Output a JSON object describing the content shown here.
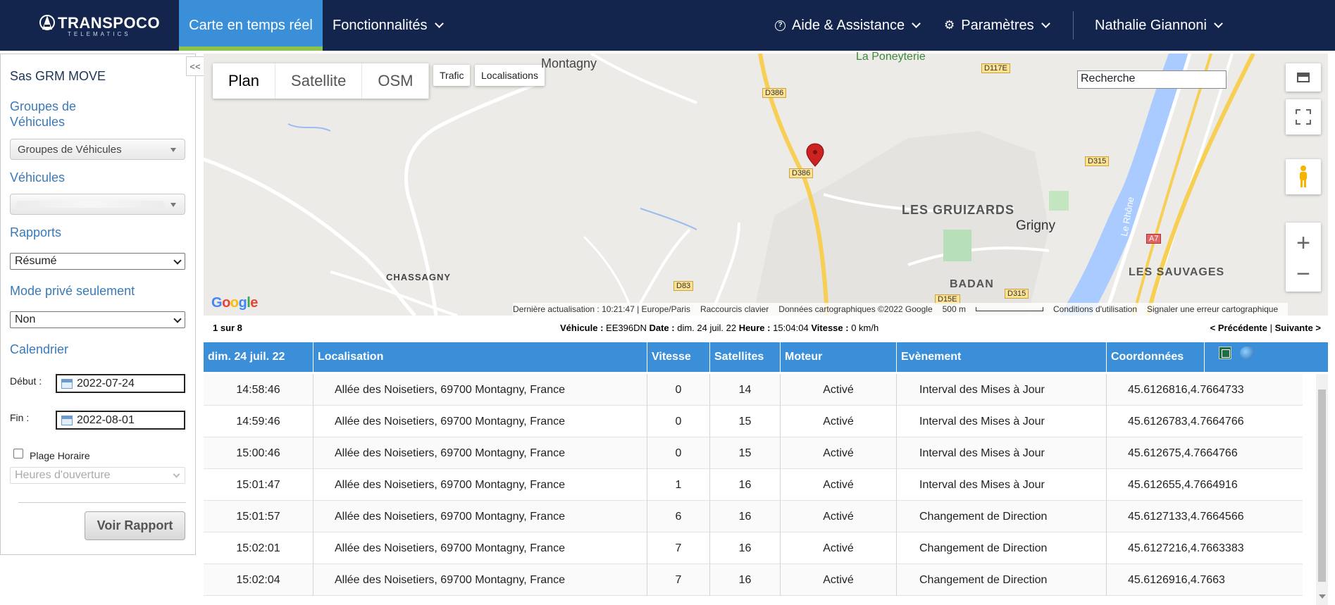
{
  "app": {
    "logo_text": "TRANSPOCO",
    "logo_sub": "TELEMATICS"
  },
  "nav": {
    "active": "Carte en temps réel",
    "features": "Fonctionnalités",
    "help": "Aide & Assistance",
    "settings": "Paramètres",
    "user": "Nathalie Giannoni"
  },
  "sidebar": {
    "collapse": "<<",
    "company": "Sas GRM MOVE",
    "groups_label": "Groupes de Véhicules",
    "groups_select": "Groupes de Véhicules",
    "vehicles_label": "Véhicules",
    "reports_label": "Rapports",
    "report_select": "Résumé",
    "private_label": "Mode privé seulement",
    "private_select": "Non",
    "calendar_label": "Calendrier",
    "start_label": "Début :",
    "start_value": "2022-07-24",
    "end_label": "Fin :",
    "end_value": "2022-08-01",
    "time_range_label": "Plage Horaire",
    "hours_select": "Heures d'ouverture",
    "report_button": "Voir Rapport"
  },
  "map": {
    "tabs": [
      "Plan",
      "Satellite",
      "OSM"
    ],
    "traffic_btn": "Trafic",
    "locations_btn": "Localisations",
    "search_placeholder": "Recherche",
    "labels": {
      "montagny": "Montagny",
      "poneyterie": "La Poneyterie",
      "gruizards": "LES GRUIZARDS",
      "grigny": "Grigny",
      "chassagny": "CHASSAGNY",
      "badan": "BADAN",
      "sauvages": "LES SAUVAGES",
      "rhone": "Le Rhône"
    },
    "roads": [
      "D386",
      "D386",
      "D117E",
      "D315",
      "D315",
      "D83",
      "D15E",
      "A7"
    ],
    "footer": {
      "last_update": "Dernière actualisation : 10:21:47 | Europe/Paris",
      "shortcuts": "Raccourcis clavier",
      "data": "Données cartographiques ©2022 Google",
      "scale": "500 m",
      "terms": "Conditions d'utilisation",
      "report": "Signaler une erreur cartographique"
    },
    "google": "Google"
  },
  "info": {
    "page": "1 sur 8",
    "vehicle_label": "Véhicule :",
    "vehicle": "EE396DN",
    "date_label": "Date :",
    "date": "dim. 24 juil. 22",
    "time_label": "Heure :",
    "time": "15:04:04",
    "speed_label": "Vitesse :",
    "speed": "0 km/h",
    "prev": "< Précédente",
    "sep": "|",
    "next": "Suivante >"
  },
  "table": {
    "headers": [
      "dim. 24 juil. 22",
      "Localisation",
      "Vitesse",
      "Satellites",
      "Moteur",
      "Evènement",
      "Coordonnées"
    ],
    "rows": [
      [
        "14:58:46",
        "Allée des Noisetiers, 69700 Montagny, France",
        "0",
        "14",
        "Activé",
        "Interval des Mises à Jour",
        "45.6126816,4.7664733"
      ],
      [
        "14:59:46",
        "Allée des Noisetiers, 69700 Montagny, France",
        "0",
        "15",
        "Activé",
        "Interval des Mises à Jour",
        "45.6126783,4.7664766"
      ],
      [
        "15:00:46",
        "Allée des Noisetiers, 69700 Montagny, France",
        "0",
        "15",
        "Activé",
        "Interval des Mises à Jour",
        "45.612675,4.7664766"
      ],
      [
        "15:01:47",
        "Allée des Noisetiers, 69700 Montagny, France",
        "1",
        "16",
        "Activé",
        "Interval des Mises à Jour",
        "45.612655,4.7664916"
      ],
      [
        "15:01:57",
        "Allée des Noisetiers, 69700 Montagny, France",
        "6",
        "16",
        "Activé",
        "Changement de Direction",
        "45.6127133,4.7664566"
      ],
      [
        "15:02:01",
        "Allée des Noisetiers, 69700 Montagny, France",
        "7",
        "16",
        "Activé",
        "Changement de Direction",
        "45.6127216,4.7663383"
      ],
      [
        "15:02:04",
        "Allée des Noisetiers, 69700 Montagny, France",
        "7",
        "16",
        "Activé",
        "Changement de Direction",
        "45.6126916,4.7663"
      ]
    ]
  }
}
